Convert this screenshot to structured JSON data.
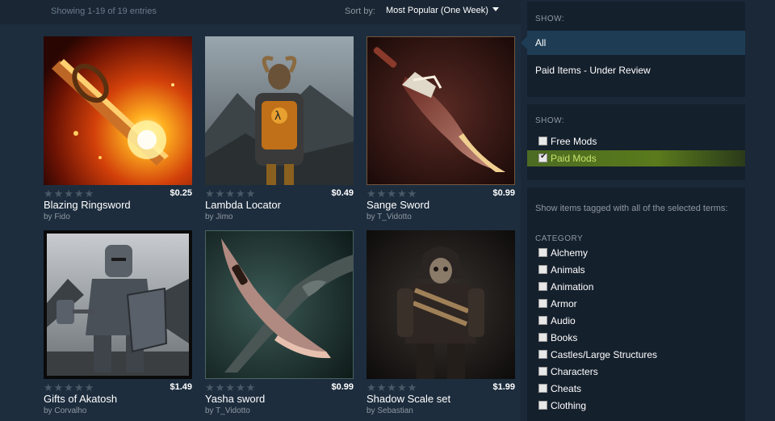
{
  "header": {
    "showing": "Showing 1-19 of 19 entries",
    "sort_label": "Sort by:",
    "sort_value": "Most Popular (One Week)"
  },
  "items": [
    {
      "title": "Blazing Ringsword",
      "author_prefix": "by",
      "author": "Fido",
      "price": "$0.25",
      "rating": "★★★★★"
    },
    {
      "title": "Lambda Locator",
      "author_prefix": "by",
      "author": "Jimo",
      "price": "$0.49",
      "rating": "★★★★★"
    },
    {
      "title": "Sange Sword",
      "author_prefix": "by",
      "author": "T_Vidotto",
      "price": "$0.99",
      "rating": "★★★★★"
    },
    {
      "title": "Gifts of Akatosh",
      "author_prefix": "by",
      "author": "Corvalho",
      "price": "$1.49",
      "rating": "★★★★★"
    },
    {
      "title": "Yasha sword",
      "author_prefix": "by",
      "author": "T_Vidotto",
      "price": "$0.99",
      "rating": "★★★★★"
    },
    {
      "title": "Shadow Scale set",
      "author_prefix": "by",
      "author": "Sebastian",
      "price": "$1.99",
      "rating": "★★★★★"
    }
  ],
  "sidebar": {
    "show1": {
      "label": "SHOW:",
      "items": [
        "All",
        "Paid Items - Under Review"
      ]
    },
    "show2": {
      "label": "SHOW:",
      "items": [
        {
          "label": "Free Mods",
          "checked": false
        },
        {
          "label": "Paid Mods",
          "checked": true
        }
      ]
    },
    "tags": {
      "description": "Show items tagged with all of the selected terms:",
      "category_label": "CATEGORY",
      "items": [
        "Alchemy",
        "Animals",
        "Animation",
        "Armor",
        "Audio",
        "Books",
        "Castles/Large Structures",
        "Characters",
        "Cheats",
        "Clothing"
      ]
    }
  }
}
